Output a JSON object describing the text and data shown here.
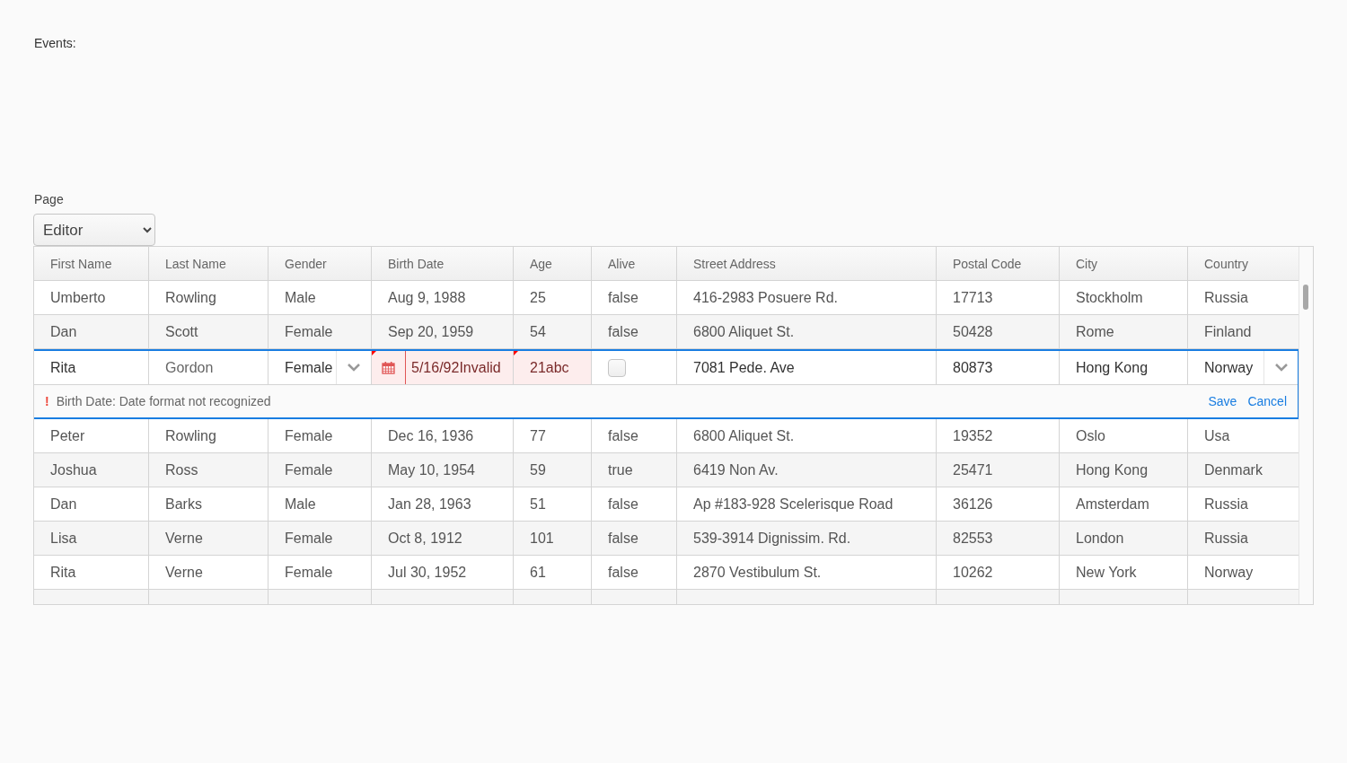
{
  "events_label": "Events:",
  "page_field": {
    "label": "Page",
    "value": "Editor"
  },
  "table": {
    "columns": [
      "First Name",
      "Last Name",
      "Gender",
      "Birth Date",
      "Age",
      "Alive",
      "Street Address",
      "Postal Code",
      "City",
      "Country"
    ],
    "rows": [
      {
        "kind": "data",
        "cells": [
          "Umberto",
          "Rowling",
          "Male",
          "Aug 9, 1988",
          "25",
          "false",
          "416-2983 Posuere Rd.",
          "17713",
          "Stockholm",
          "Russia"
        ]
      },
      {
        "kind": "data",
        "cells": [
          "Dan",
          "Scott",
          "Female",
          "Sep 20, 1959",
          "54",
          "false",
          "6800 Aliquet St.",
          "50428",
          "Rome",
          "Finland"
        ]
      },
      {
        "kind": "editor",
        "first_name": "Rita",
        "last_name": "Gordon",
        "gender": "Female",
        "birth_date": {
          "value": "5/16/92Invalid",
          "invalid": true
        },
        "age": {
          "value": "21abc",
          "invalid": true
        },
        "alive": {
          "checked": false
        },
        "street": "7081 Pede. Ave",
        "postal_code": "80873",
        "city": "Hong Kong",
        "country": "Norway",
        "error": "Birth Date: Date format not recognized",
        "error_mark": "!",
        "save": "Save",
        "cancel": "Cancel"
      },
      {
        "kind": "data",
        "cells": [
          "Peter",
          "Rowling",
          "Female",
          "Dec 16, 1936",
          "77",
          "false",
          "6800 Aliquet St.",
          "19352",
          "Oslo",
          "Usa"
        ]
      },
      {
        "kind": "data",
        "cells": [
          "Joshua",
          "Ross",
          "Female",
          "May 10, 1954",
          "59",
          "true",
          "6419 Non Av.",
          "25471",
          "Hong Kong",
          "Denmark"
        ]
      },
      {
        "kind": "data",
        "cells": [
          "Dan",
          "Barks",
          "Male",
          "Jan 28, 1963",
          "51",
          "false",
          "Ap #183-928 Scelerisque Road",
          "36126",
          "Amsterdam",
          "Russia"
        ]
      },
      {
        "kind": "data",
        "cells": [
          "Lisa",
          "Verne",
          "Female",
          "Oct 8, 1912",
          "101",
          "false",
          "539-3914 Dignissim. Rd.",
          "82553",
          "London",
          "Russia"
        ]
      },
      {
        "kind": "data",
        "cells": [
          "Rita",
          "Verne",
          "Female",
          "Jul 30, 1952",
          "61",
          "false",
          "2870 Vestibulum St.",
          "10262",
          "New York",
          "Norway"
        ]
      }
    ]
  }
}
